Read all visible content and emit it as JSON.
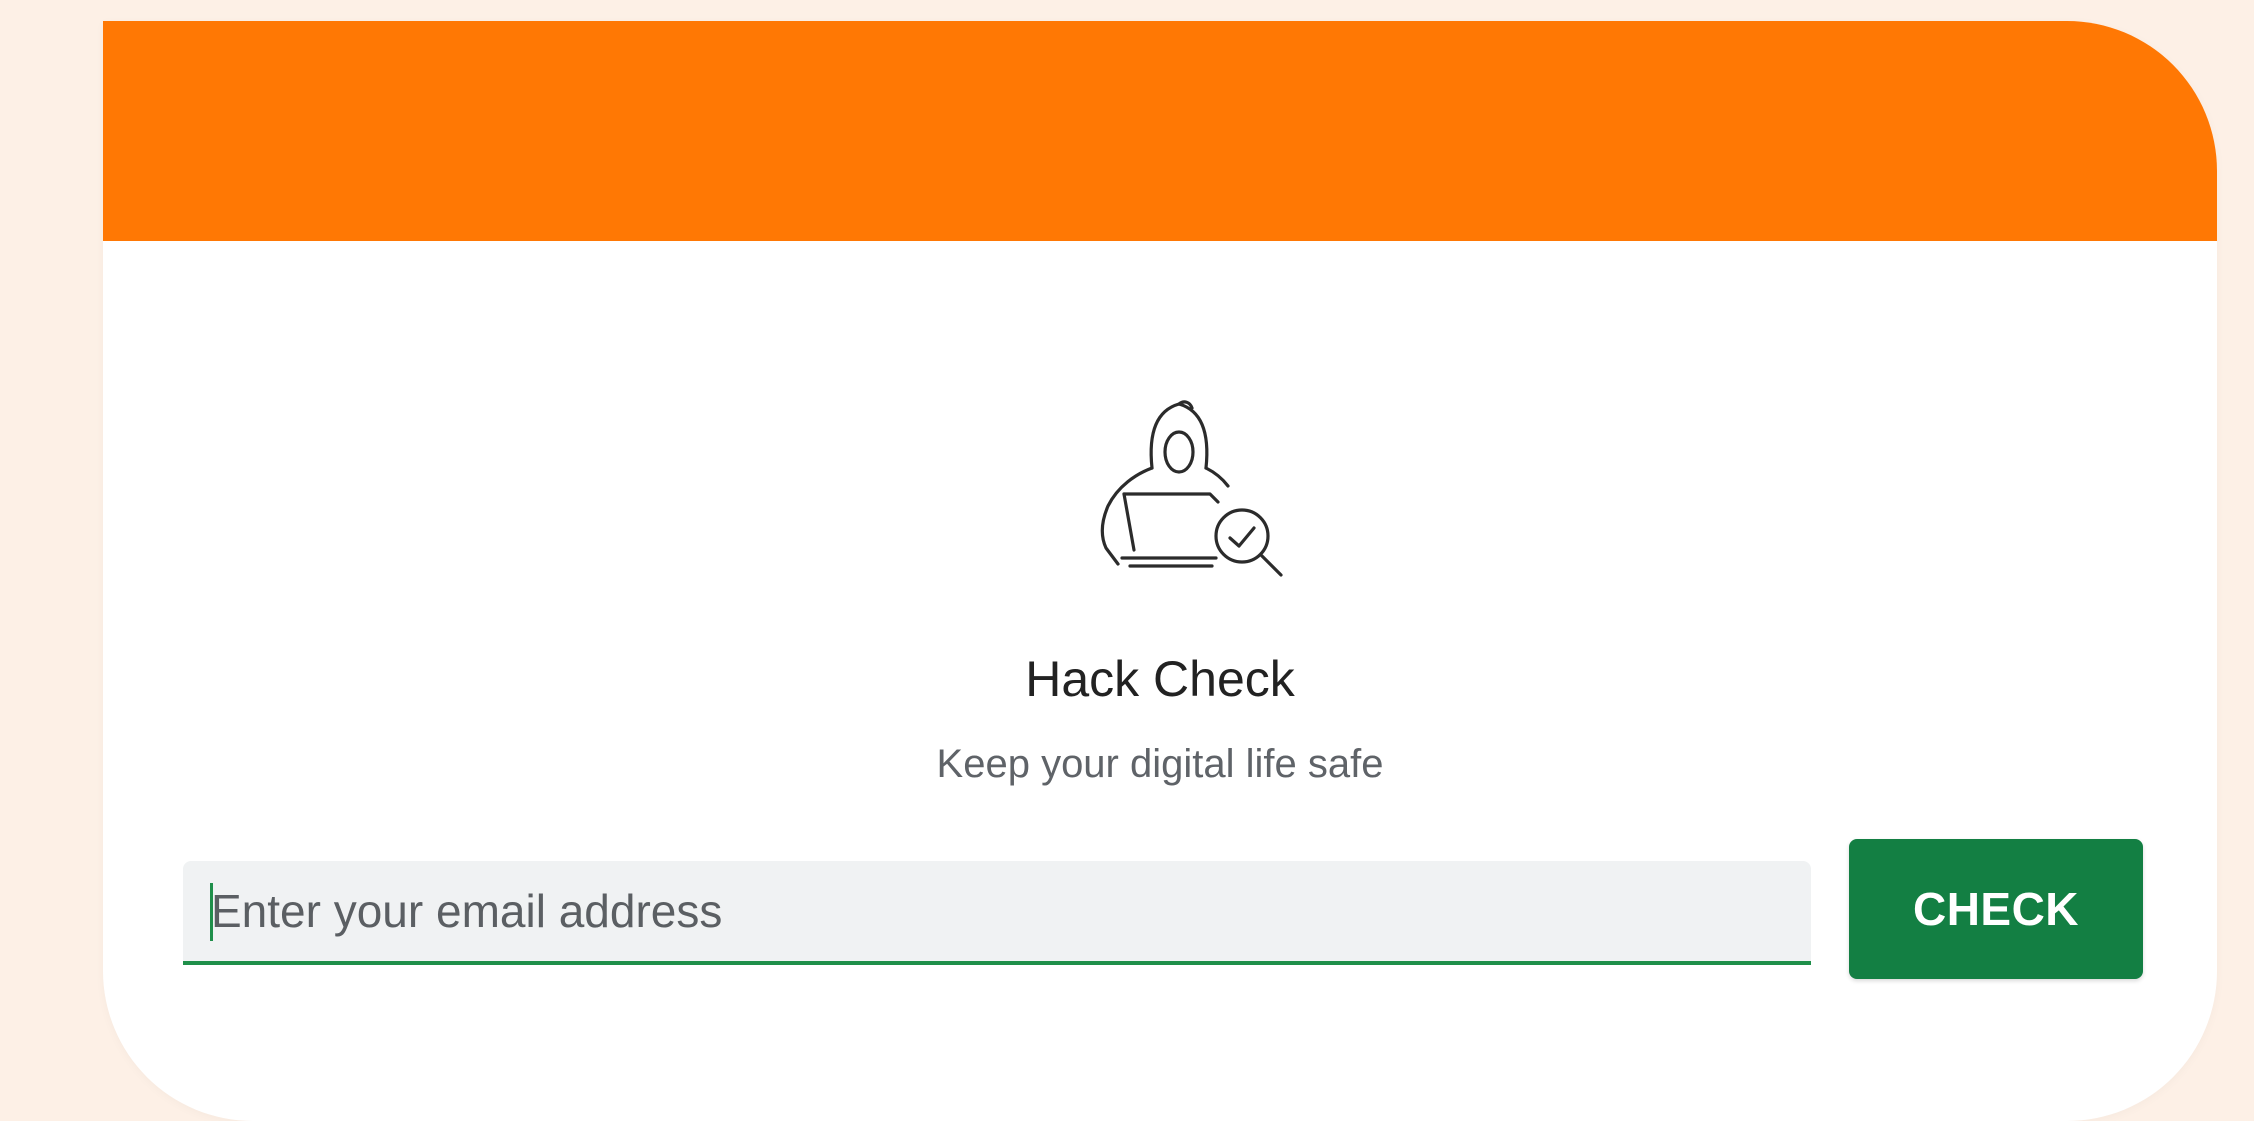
{
  "app": {
    "title": "Hack Check",
    "subtitle": "Keep your digital life safe"
  },
  "form": {
    "email_placeholder": "Enter your email address",
    "email_value": "",
    "check_label": "CHECK"
  },
  "icons": {
    "hero": "hacker-laptop-search-icon"
  },
  "colors": {
    "banner": "#ff7804",
    "button": "#137f43",
    "underline": "#1f8f4a",
    "page_background": "#fdf0e6"
  }
}
